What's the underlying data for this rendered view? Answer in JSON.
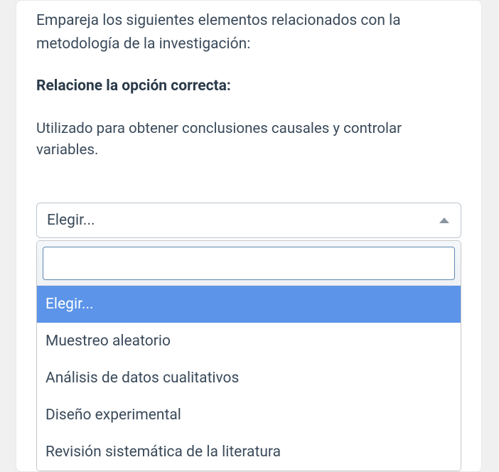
{
  "question": {
    "intro": "Empareja los siguientes elementos relacionados con la metodología de la investigación:",
    "prompt": "Relacione la opción correcta:",
    "description": "Utilizado para obtener conclusiones causales y controlar variables."
  },
  "select": {
    "placeholder": "Elegir...",
    "search_value": "",
    "options": [
      "Elegir...",
      "Muestreo aleatorio",
      "Análisis de datos cualitativos",
      "Diseño experimental",
      "Revisión sistemática de la literatura"
    ],
    "highlighted_index": 0
  }
}
